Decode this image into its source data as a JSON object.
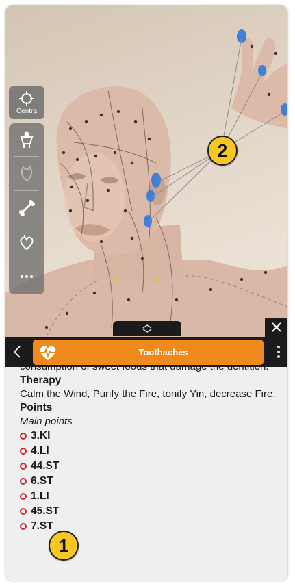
{
  "toolbar": {
    "center_label": "Centra"
  },
  "header": {
    "title": "Toothaches"
  },
  "content": {
    "intro_text": "consumption of sweet foods that damage the dentition.",
    "therapy_title": "Therapy",
    "therapy_text": "Calm the Wind, Purify the Fire, tonify Yin, decrease Fire.",
    "points_title": "Points",
    "points_subtitle": "Main points",
    "points": [
      "3.KI",
      "4.LI",
      "44.ST",
      "6.ST",
      "1.LI",
      "45.ST",
      "7.ST"
    ]
  },
  "annotations": {
    "badge_1": "1",
    "badge_2": "2"
  },
  "colors": {
    "accent": "#f08a1c",
    "header_bg": "#1b1b1b",
    "point_dot": "#d0262a",
    "badge": "#f6c623"
  }
}
